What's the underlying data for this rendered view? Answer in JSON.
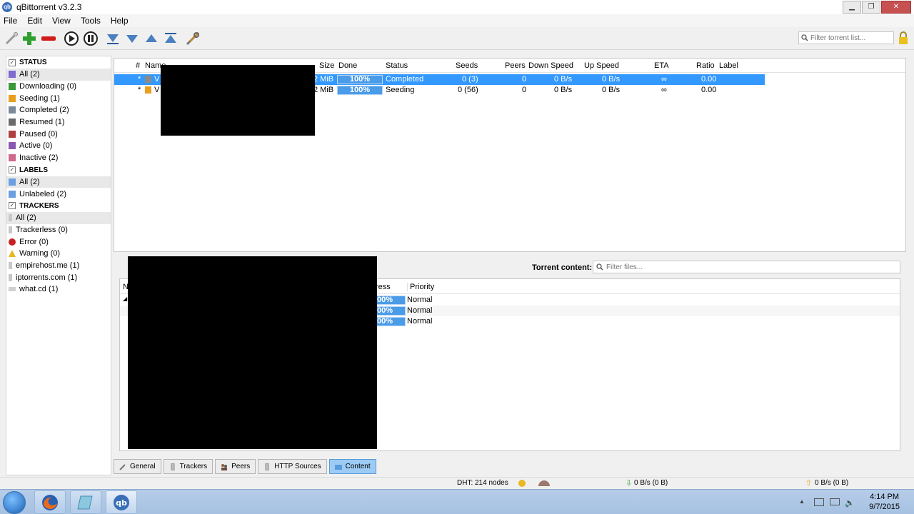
{
  "window": {
    "title": "qBittorrent v3.2.3",
    "app_icon_label": "qb"
  },
  "menu": [
    "File",
    "Edit",
    "View",
    "Tools",
    "Help"
  ],
  "toolbar": {
    "search_placeholder": "Filter torrent list..."
  },
  "sidebar": {
    "status_header": "STATUS",
    "status_items": [
      "All (2)",
      "Downloading (0)",
      "Seeding (1)",
      "Completed (2)",
      "Resumed (1)",
      "Paused (0)",
      "Active (0)",
      "Inactive (2)"
    ],
    "labels_header": "LABELS",
    "label_items": [
      "All (2)",
      "Unlabeled (2)"
    ],
    "trackers_header": "TRACKERS",
    "tracker_items": [
      "All (2)",
      "Trackerless (0)",
      "Error (0)",
      "Warning (0)",
      "empirehost.me (1)",
      "iptorrents.com (1)",
      "what.cd (1)"
    ]
  },
  "transfer_list": {
    "columns": {
      "num": "#",
      "name": "Name",
      "size": "Size",
      "done": "Done",
      "status": "Status",
      "seeds": "Seeds",
      "peers": "Peers",
      "down": "Down Speed",
      "up": "Up Speed",
      "eta": "ETA",
      "ratio": "Ratio",
      "label": "Label"
    },
    "rows": [
      {
        "num": "*",
        "name": "V",
        "size": "2 MiB",
        "done": "100%",
        "progress": 1.0,
        "status": "Completed",
        "seeds": "0 (3)",
        "peers": "0",
        "down": "0 B/s",
        "up": "0 B/s",
        "eta": "∞",
        "ratio": "0.00"
      },
      {
        "num": "*",
        "name": "V",
        "size": "2 MiB",
        "done": "100%",
        "progress": 1.0,
        "status": "Seeding",
        "seeds": "0 (56)",
        "peers": "0",
        "down": "0 B/s",
        "up": "0 B/s",
        "eta": "∞",
        "ratio": "0.00"
      }
    ]
  },
  "properties": {
    "torrent_content_label": "Torrent content:",
    "filter_placeholder": "Filter files...",
    "content_columns": {
      "name": "N",
      "progress": "ress",
      "priority": "Priority"
    },
    "content_rows": [
      {
        "progress": "00%",
        "priority": "Normal"
      },
      {
        "progress": "00%",
        "priority": "Normal"
      },
      {
        "progress": "00%",
        "priority": "Normal"
      }
    ],
    "tabs": [
      "General",
      "Trackers",
      "Peers",
      "HTTP Sources",
      "Content"
    ]
  },
  "statusbar": {
    "dht": "DHT: 214 nodes",
    "down": "0 B/s (0 B)",
    "up": "0 B/s (0 B)"
  },
  "taskbar": {
    "time": "4:14 PM",
    "date": "9/7/2015"
  },
  "colors": {
    "selection": "#3399ff",
    "progress": "#4a9be8",
    "active_tab": "#9ccbf4"
  }
}
